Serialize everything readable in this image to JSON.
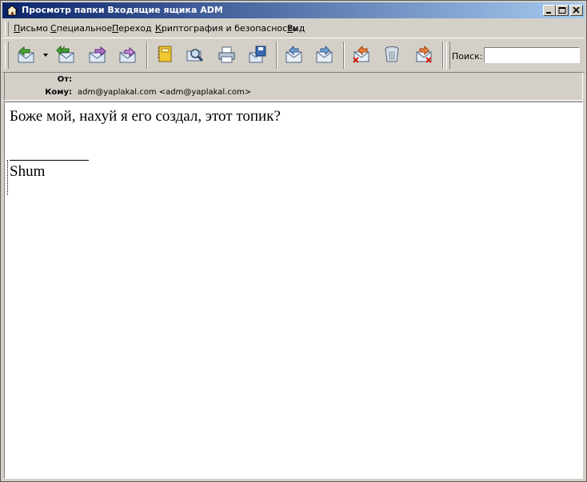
{
  "window": {
    "title": "Просмотр папки Входящие ящика ADM"
  },
  "menu": {
    "items": [
      {
        "underline": "П",
        "rest": "исьмо"
      },
      {
        "underline": "С",
        "rest": "пециальное"
      },
      {
        "underline": "П",
        "rest": "ереход"
      },
      {
        "underline": "К",
        "rest": "риптография и безопасность"
      },
      {
        "underline": "В",
        "rest": "ид"
      }
    ]
  },
  "toolbar": {
    "search_label": "Поиск:",
    "search_value": ""
  },
  "headers": {
    "from_label": "От:",
    "from_value": "",
    "to_label": "Кому:",
    "to_value": "adm@yaplakal.com <adm@yaplakal.com>"
  },
  "message": {
    "text": "Боже мой, нахуй я его создал, этот топик?",
    "signature": "Shum"
  },
  "colors": {
    "titlebar_start": "#0a246a",
    "titlebar_end": "#a6caf0",
    "chrome": "#d4d0c8"
  }
}
